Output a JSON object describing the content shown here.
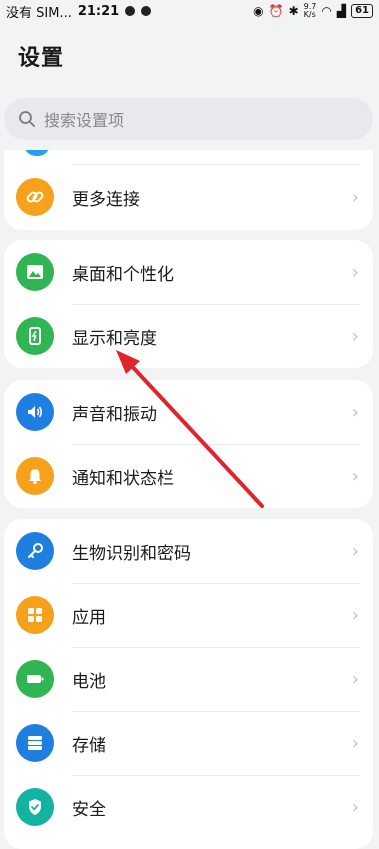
{
  "status_bar": {
    "carrier": "没有 SIM...",
    "time": "21:21",
    "speed": "9.7\nK/s",
    "battery": "61"
  },
  "page": {
    "title": "设置"
  },
  "search": {
    "placeholder": "搜索设置项"
  },
  "colors": {
    "orange": "#f5a11c",
    "green": "#34c759",
    "blue": "#1e88e5",
    "teal": "#12b886",
    "arrow": "#e0242c"
  },
  "groups": [
    {
      "items": [
        {
          "label": "更多连接",
          "icon": "link-icon",
          "color": "#f5a11c"
        }
      ]
    },
    {
      "items": [
        {
          "label": "桌面和个性化",
          "icon": "image-icon",
          "color": "#2fb552"
        },
        {
          "label": "显示和亮度",
          "icon": "phone-brightness-icon",
          "color": "#2fb552"
        }
      ]
    },
    {
      "items": [
        {
          "label": "声音和振动",
          "icon": "speaker-icon",
          "color": "#1e7fe0"
        },
        {
          "label": "通知和状态栏",
          "icon": "bell-icon",
          "color": "#f5a11c"
        }
      ]
    },
    {
      "items": [
        {
          "label": "生物识别和密码",
          "icon": "key-icon",
          "color": "#1e7fe0"
        },
        {
          "label": "应用",
          "icon": "apps-grid-icon",
          "color": "#f5a11c"
        },
        {
          "label": "电池",
          "icon": "battery-icon",
          "color": "#2fb552"
        },
        {
          "label": "存储",
          "icon": "storage-icon",
          "color": "#1e7fe0"
        },
        {
          "label": "安全",
          "icon": "shield-icon",
          "color": "#12b3a0"
        }
      ]
    }
  ]
}
